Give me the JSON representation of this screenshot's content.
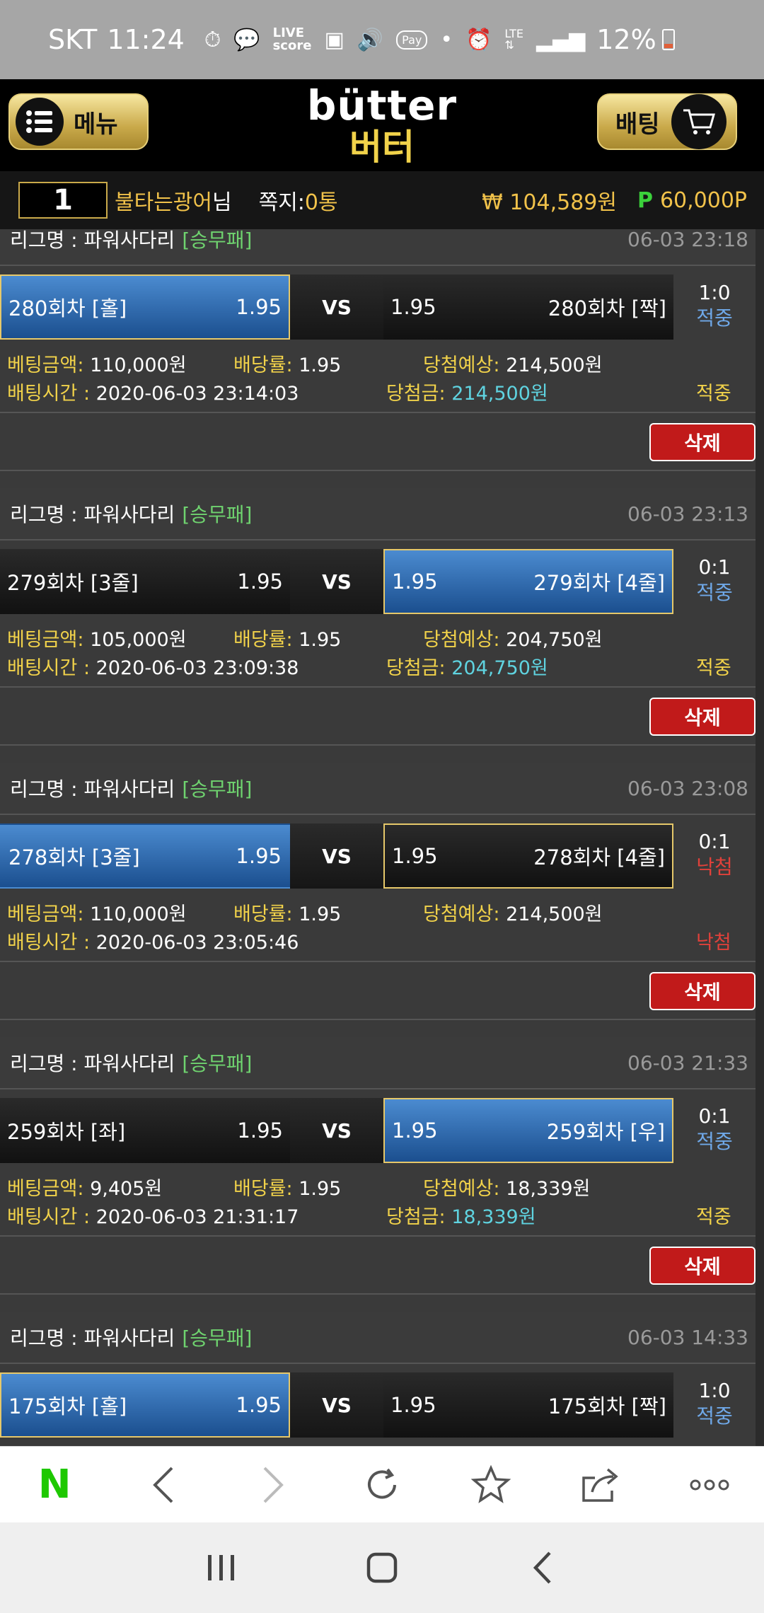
{
  "status": {
    "carrier": "SKT",
    "time": "11:24",
    "battery": "12%",
    "icons": [
      "timer-icon",
      "chat-icon",
      "livescore-icon",
      "gallery-icon",
      "volume-icon",
      "pay-icon",
      "dot-icon",
      "alarm-icon",
      "lte-icon",
      "signal-icon",
      "battery-icon"
    ]
  },
  "header": {
    "menu_label": "메뉴",
    "bet_label": "배팅",
    "logo_en": "bütter",
    "logo_ko": "버터"
  },
  "user": {
    "level": "1",
    "name": "불타는광어",
    "name_suffix": "님",
    "messages_label": "쪽지:",
    "messages_count": "0통",
    "money": "₩ 104,589원",
    "points_prefix": "P",
    "points": "60,000P"
  },
  "tickets": [
    {
      "league": "리그명 : 파워사다리",
      "tag": "[승무패]",
      "time": "06-03 23:18",
      "home": "280회차 [홀]",
      "home_odds": "1.95",
      "vs": "VS",
      "away_odds": "1.95",
      "away": "280회차 [짝]",
      "score": "1:0",
      "result": "적중",
      "amount_label": "베팅금액:",
      "amount": "110,000원",
      "rate_label": "배당률:",
      "rate": "1.95",
      "expect_label": "당첨예상:",
      "expect": "214,500원",
      "time_label": "배팅시간 :",
      "bet_time": "2020-06-03 23:14:03",
      "win_label": "당첨금:",
      "win": "214,500원",
      "status": "적중",
      "delete": "삭제"
    },
    {
      "league": "리그명 : 파워사다리",
      "tag": "[승무패]",
      "time": "06-03 23:13",
      "home": "279회차 [3줄]",
      "home_odds": "1.95",
      "vs": "VS",
      "away_odds": "1.95",
      "away": "279회차 [4줄]",
      "score": "0:1",
      "result": "적중",
      "amount_label": "베팅금액:",
      "amount": "105,000원",
      "rate_label": "배당률:",
      "rate": "1.95",
      "expect_label": "당첨예상:",
      "expect": "204,750원",
      "time_label": "배팅시간 :",
      "bet_time": "2020-06-03 23:09:38",
      "win_label": "당첨금:",
      "win": "204,750원",
      "status": "적중",
      "delete": "삭제"
    },
    {
      "league": "리그명 : 파워사다리",
      "tag": "[승무패]",
      "time": "06-03 23:08",
      "home": "278회차 [3줄]",
      "home_odds": "1.95",
      "vs": "VS",
      "away_odds": "1.95",
      "away": "278회차 [4줄]",
      "score": "0:1",
      "result": "낙첨",
      "amount_label": "베팅금액:",
      "amount": "110,000원",
      "rate_label": "배당률:",
      "rate": "1.95",
      "expect_label": "당첨예상:",
      "expect": "214,500원",
      "time_label": "배팅시간 :",
      "bet_time": "2020-06-03 23:05:46",
      "win_label": "",
      "win": "",
      "status": "낙첨",
      "delete": "삭제"
    },
    {
      "league": "리그명 : 파워사다리",
      "tag": "[승무패]",
      "time": "06-03 21:33",
      "home": "259회차 [좌]",
      "home_odds": "1.95",
      "vs": "VS",
      "away_odds": "1.95",
      "away": "259회차 [우]",
      "score": "0:1",
      "result": "적중",
      "amount_label": "베팅금액:",
      "amount": "9,405원",
      "rate_label": "배당률:",
      "rate": "1.95",
      "expect_label": "당첨예상:",
      "expect": "18,339원",
      "time_label": "배팅시간 :",
      "bet_time": "2020-06-03 21:31:17",
      "win_label": "당첨금:",
      "win": "18,339원",
      "status": "적중",
      "delete": "삭제"
    },
    {
      "league": "리그명 : 파워사다리",
      "tag": "[승무패]",
      "time": "06-03 14:33",
      "home": "175회차 [홀]",
      "home_odds": "1.95",
      "vs": "VS",
      "away_odds": "1.95",
      "away": "175회차 [짝]",
      "score": "1:0",
      "result": "적중"
    }
  ],
  "browser": {
    "icons": [
      "naver-icon",
      "back-icon",
      "forward-icon",
      "refresh-icon",
      "bookmark-icon",
      "share-icon",
      "more-icon"
    ]
  },
  "nav": {
    "icons": [
      "recent-apps-icon",
      "home-icon",
      "back-icon"
    ]
  }
}
